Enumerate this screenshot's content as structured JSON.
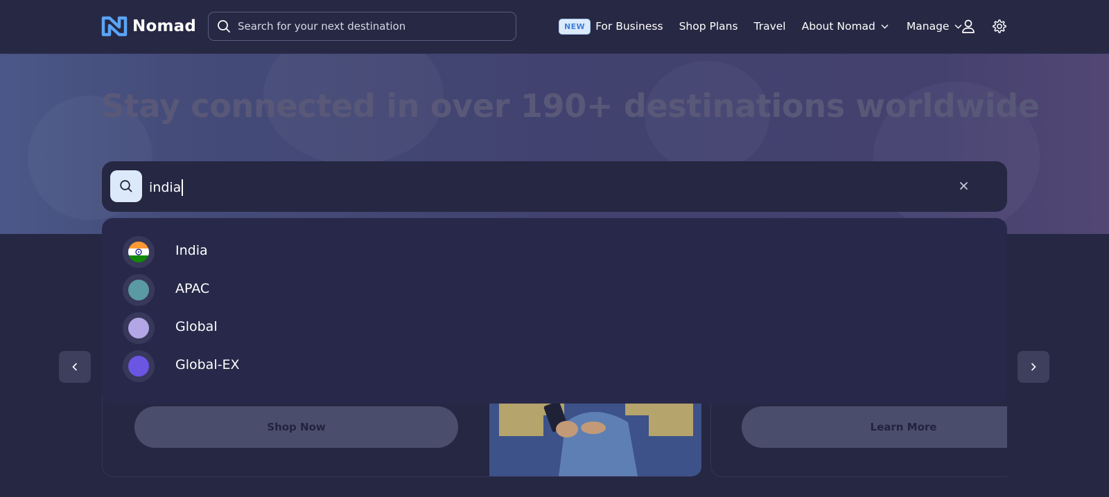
{
  "brand": {
    "name": "Nomad",
    "accent": "#5ba4f5"
  },
  "nav": {
    "search_placeholder": "Search for your next destination",
    "badge_new": "NEW",
    "links": [
      "For Business",
      "Shop Plans",
      "Travel",
      "About Nomad",
      "Manage"
    ],
    "icons": [
      "account-icon",
      "settings-icon"
    ]
  },
  "hero": {
    "title": "Stay connected in over 190+ destinations worldwide"
  },
  "destination_search": {
    "query": "india",
    "clear_icon": "close-icon"
  },
  "results": [
    {
      "label": "India",
      "icon": "india-flag-icon",
      "color": "#ff9933"
    },
    {
      "label": "APAC",
      "icon": "region-dot-icon",
      "color": "#5a9aa2"
    },
    {
      "label": "Global",
      "icon": "region-dot-icon",
      "color": "#b3a6e6"
    },
    {
      "label": "Global-EX",
      "icon": "region-dot-icon",
      "color": "#6b55e3"
    }
  ],
  "cards": {
    "shop_now": "Shop Now",
    "learn_more": "Learn More"
  }
}
